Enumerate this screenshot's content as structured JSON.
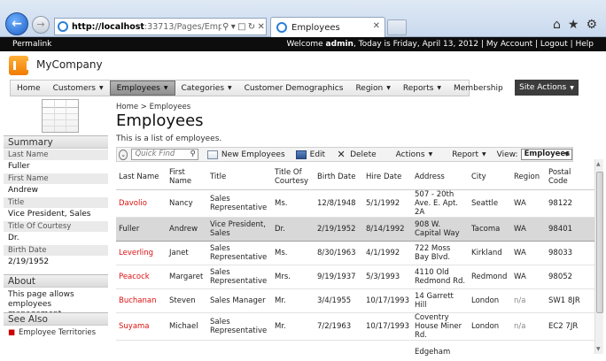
{
  "browser": {
    "url_host": "http://localhost",
    "url_rest": ":33713/Pages/Employe",
    "tab_title": "Employees"
  },
  "topbar": {
    "permalink": "Permalink",
    "welcome_prefix": "Welcome ",
    "user": "admin",
    "welcome_suffix": ", Today is Friday, April 13, 2012 | My Account | Logout | Help"
  },
  "header": {
    "company": "MyCompany"
  },
  "menu": {
    "items": [
      {
        "label": "Home",
        "has_arrow": false
      },
      {
        "label": "Customers",
        "has_arrow": true
      },
      {
        "label": "Employees",
        "has_arrow": true
      },
      {
        "label": "Categories",
        "has_arrow": true
      },
      {
        "label": "Customer Demographics",
        "has_arrow": false
      },
      {
        "label": "Region",
        "has_arrow": true
      },
      {
        "label": "Reports",
        "has_arrow": true
      },
      {
        "label": "Membership",
        "has_arrow": false
      }
    ],
    "site_actions": "Site Actions"
  },
  "sidebar": {
    "summary_title": "Summary",
    "fields": [
      {
        "label": "Last Name",
        "value": "Fuller"
      },
      {
        "label": "First Name",
        "value": "Andrew"
      },
      {
        "label": "Title",
        "value": "Vice President, Sales"
      },
      {
        "label": "Title Of Courtesy",
        "value": "Dr."
      },
      {
        "label": "Birth Date",
        "value": "2/19/1952"
      }
    ],
    "about_title": "About",
    "about_text": "This page allows employees management.",
    "see_also_title": "See Also",
    "see_also_items": [
      "Employee Territories"
    ]
  },
  "main": {
    "breadcrumb": "Home > Employees",
    "title": "Employees",
    "description": "This is a list of employees.",
    "toolbar": {
      "quick_find_placeholder": "Quick Find",
      "new_label": "New Employees",
      "edit_label": "Edit",
      "delete_label": "Delete",
      "actions_label": "Actions",
      "report_label": "Report",
      "view_label": "View:",
      "view_value": "Employees"
    },
    "columns": [
      "Last Name",
      "First Name",
      "Title",
      "Title Of Courtesy",
      "Birth Date",
      "Hire Date",
      "Address",
      "City",
      "Region",
      "Postal Code"
    ],
    "rows": [
      {
        "last": "Davolio",
        "first": "Nancy",
        "title": "Sales Representative",
        "courtesy": "Ms.",
        "birth": "12/8/1948",
        "hire": "5/1/1992",
        "address": "507 - 20th Ave. E. Apt. 2A",
        "city": "Seattle",
        "region": "WA",
        "postal": "98122"
      },
      {
        "last": "Fuller",
        "first": "Andrew",
        "title": "Vice President, Sales",
        "courtesy": "Dr.",
        "birth": "2/19/1952",
        "hire": "8/14/1992",
        "address": "908 W. Capital Way",
        "city": "Tacoma",
        "region": "WA",
        "postal": "98401"
      },
      {
        "last": "Leverling",
        "first": "Janet",
        "title": "Sales Representative",
        "courtesy": "Ms.",
        "birth": "8/30/1963",
        "hire": "4/1/1992",
        "address": "722 Moss Bay Blvd.",
        "city": "Kirkland",
        "region": "WA",
        "postal": "98033"
      },
      {
        "last": "Peacock",
        "first": "Margaret",
        "title": "Sales Representative",
        "courtesy": "Mrs.",
        "birth": "9/19/1937",
        "hire": "5/3/1993",
        "address": "4110 Old Redmond Rd.",
        "city": "Redmond",
        "region": "WA",
        "postal": "98052"
      },
      {
        "last": "Buchanan",
        "first": "Steven",
        "title": "Sales Manager",
        "courtesy": "Mr.",
        "birth": "3/4/1955",
        "hire": "10/17/1993",
        "address": "14 Garrett Hill",
        "city": "London",
        "region": "n/a",
        "postal": "SW1 8JR"
      },
      {
        "last": "Suyama",
        "first": "Michael",
        "title": "Sales Representative",
        "courtesy": "Mr.",
        "birth": "7/2/1963",
        "hire": "10/17/1993",
        "address": "Coventry House Miner Rd.",
        "city": "London",
        "region": "n/a",
        "postal": "EC2 7JR"
      },
      {
        "last": "",
        "first": "",
        "title": "",
        "courtesy": "",
        "birth": "",
        "hire": "",
        "address": "Edgeham",
        "city": "",
        "region": "",
        "postal": ""
      }
    ],
    "selected_row": 1
  }
}
